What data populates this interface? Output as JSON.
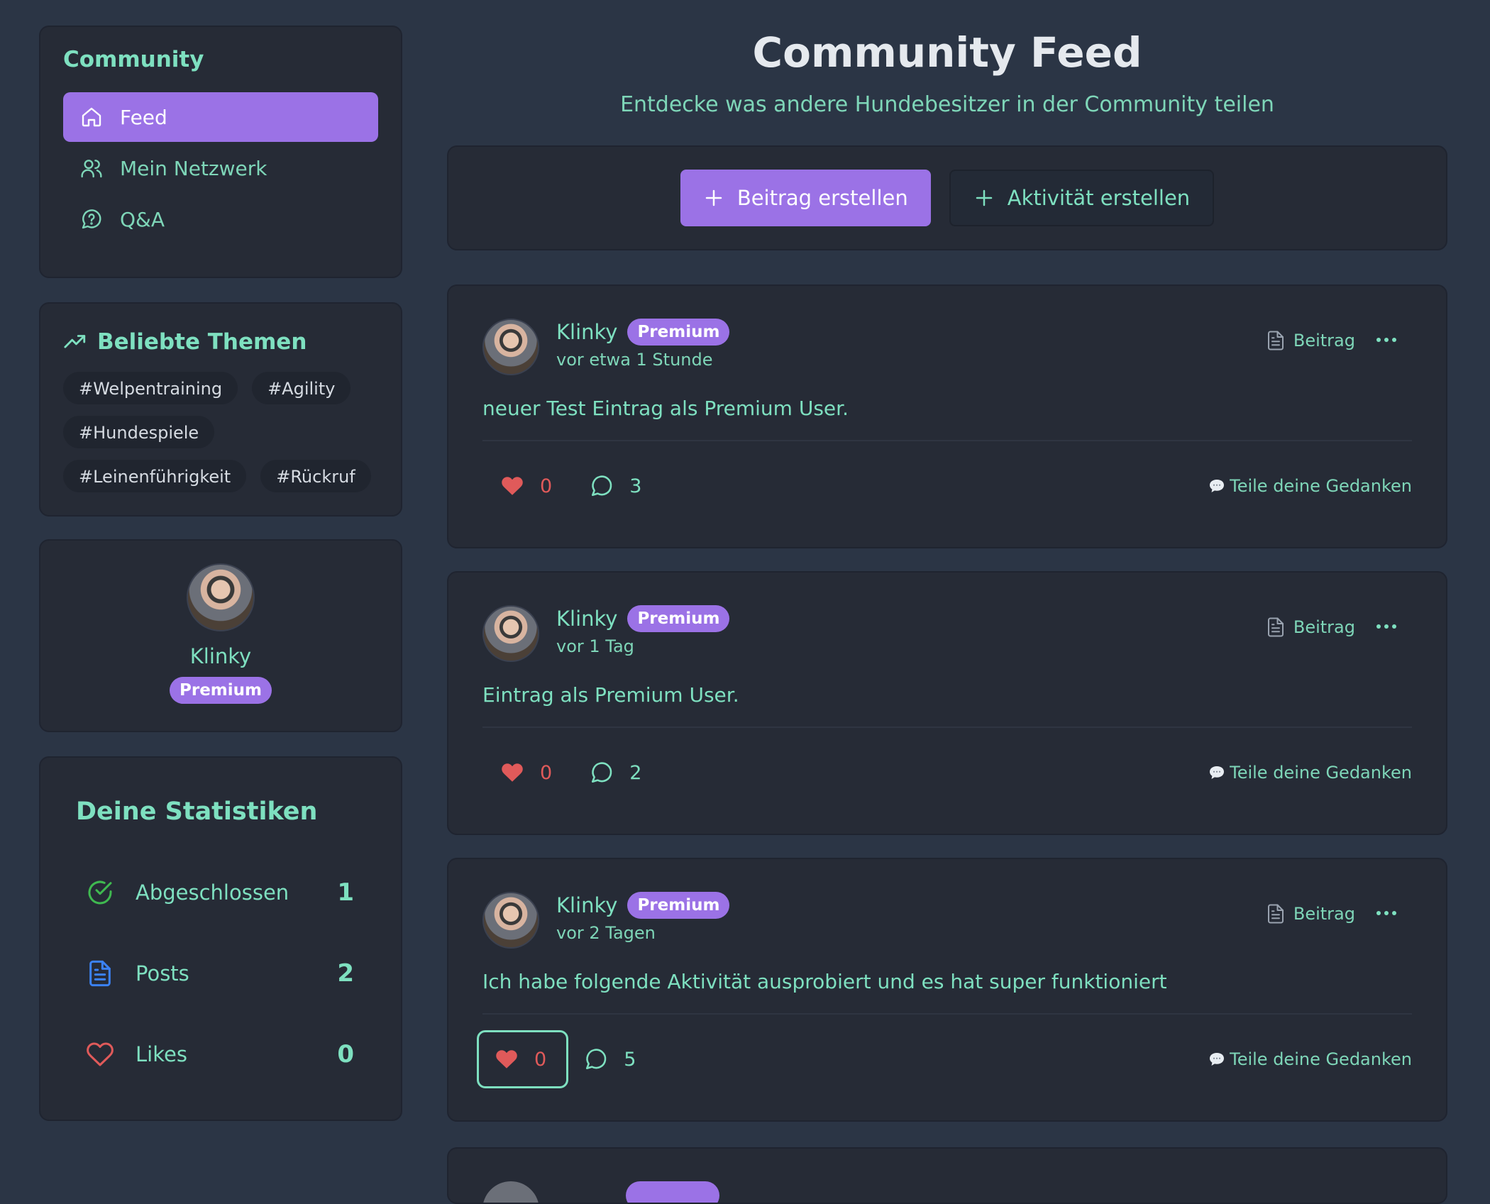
{
  "sidebar": {
    "nav": {
      "title": "Community",
      "items": [
        {
          "label": "Feed",
          "icon": "home-icon",
          "active": true
        },
        {
          "label": "Mein Netzwerk",
          "icon": "users-icon",
          "active": false
        },
        {
          "label": "Q&A",
          "icon": "question-bubble-icon",
          "active": false
        }
      ]
    },
    "topics": {
      "title": "Beliebte Themen",
      "tags": [
        "#Welpentraining",
        "#Agility",
        "#Hundespiele",
        "#Leinenführigkeit",
        "#Rückruf"
      ]
    },
    "profile": {
      "name": "Klinky",
      "badge": "Premium"
    },
    "stats": {
      "title": "Deine Statistiken",
      "items": [
        {
          "label": "Abgeschlossen",
          "value": "1",
          "icon": "check-circle-icon",
          "color": "#3fb950"
        },
        {
          "label": "Posts",
          "value": "2",
          "icon": "document-icon",
          "color": "#3b82f6"
        },
        {
          "label": "Likes",
          "value": "0",
          "icon": "heart-outline-icon",
          "color": "#e05a5a"
        }
      ]
    }
  },
  "main": {
    "title": "Community Feed",
    "subtitle": "Entdecke was andere Hundebesitzer in der Community teilen",
    "actions": {
      "create_post": "Beitrag erstellen",
      "create_activity": "Aktivität erstellen"
    },
    "posts": [
      {
        "author": "Klinky",
        "badge": "Premium",
        "time": "vor etwa 1 Stunde",
        "type": "Beitrag",
        "content": "neuer Test Eintrag als Premium User.",
        "likes": "0",
        "comments": "3",
        "share": "Teile deine Gedanken"
      },
      {
        "author": "Klinky",
        "badge": "Premium",
        "time": "vor 1 Tag",
        "type": "Beitrag",
        "content": "Eintrag als Premium User.",
        "likes": "0",
        "comments": "2",
        "share": "Teile deine Gedanken"
      },
      {
        "author": "Klinky",
        "badge": "Premium",
        "time": "vor 2 Tagen",
        "type": "Beitrag",
        "content": "Ich habe folgende Aktivität ausprobiert und es hat super funktioniert",
        "likes": "0",
        "comments": "5",
        "share": "Teile deine Gedanken"
      }
    ]
  },
  "colors": {
    "background": "#2b3545",
    "card": "#262b36",
    "accent_purple": "#9b72e6",
    "text_mint": "#7ee0c0",
    "like_red": "#e05a5a"
  }
}
